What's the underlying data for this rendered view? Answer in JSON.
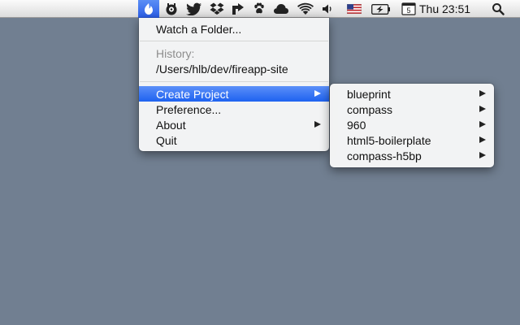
{
  "menubar": {
    "status_icons": [
      "fireapp-icon",
      "monster-icon",
      "twitter-icon",
      "dropbox-icon",
      "forward-arrows-icon",
      "paw-icon",
      "cloud-icon",
      "wifi-icon",
      "volume-icon",
      "us-flag-icon",
      "battery-charging-icon",
      "calendar-icon",
      "spotlight-search-icon"
    ],
    "calendar_day": "5",
    "clock": "Thu 23:51"
  },
  "main_menu": {
    "watch_folder": "Watch a Folder...",
    "history_label": "History:",
    "history_path": "/Users/hlb/dev/fireapp-site",
    "create_project": "Create Project",
    "preference": "Preference...",
    "about": "About",
    "quit": "Quit"
  },
  "sub_menu": {
    "items": [
      "blueprint",
      "compass",
      "960",
      "html5-boilerplate",
      "compass-h5bp"
    ]
  },
  "colors": {
    "desktop": "#717f91",
    "selection": "#2f6ef3",
    "menubar": "#e8e8e8"
  }
}
